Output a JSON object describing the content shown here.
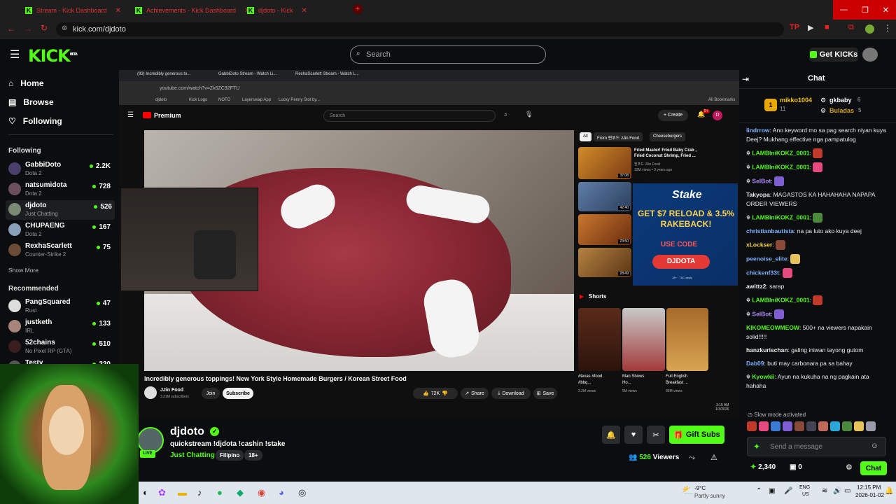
{
  "browser": {
    "tabs": [
      {
        "label": "Stream - Kick Dashboard"
      },
      {
        "label": "Achievements - Kick Dashboard"
      },
      {
        "label": "djdoto - Kick"
      }
    ],
    "url": "kick.com/djdoto"
  },
  "kick": {
    "logo": "KICK",
    "logo_sup": "BETA",
    "search_placeholder": "Search",
    "get_kicks": "Get KICKs"
  },
  "sidebar": {
    "nav": [
      {
        "label": "Home",
        "icon": "home-icon"
      },
      {
        "label": "Browse",
        "icon": "browse-icon"
      },
      {
        "label": "Following",
        "icon": "heart-icon"
      }
    ],
    "following_title": "Following",
    "following": [
      {
        "name": "GabbiDoto",
        "category": "Dota 2",
        "viewers": "2.2K"
      },
      {
        "name": "natsumidota",
        "category": "Dota 2",
        "viewers": "728"
      },
      {
        "name": "djdoto",
        "category": "Just Chatting",
        "viewers": "526"
      },
      {
        "name": "CHUPAENG",
        "category": "Dota 2",
        "viewers": "167"
      },
      {
        "name": "RexhaScarlett",
        "category": "Counter-Strike 2",
        "viewers": "75"
      }
    ],
    "show_more": "Show More",
    "recommended_title": "Recommended",
    "recommended": [
      {
        "name": "PangSquared",
        "category": "Rust",
        "viewers": "47"
      },
      {
        "name": "justketh",
        "category": "IRL",
        "viewers": "133"
      },
      {
        "name": "52chains",
        "category": "No Pixel RP (GTA)",
        "viewers": "510"
      },
      {
        "name": "Testy",
        "category": "",
        "viewers": "220"
      }
    ]
  },
  "inner": {
    "tabs": [
      "(93) Incredibly generous to...",
      "GabbiDoto Stream - Watch Li...",
      "RexhaScarlett Stream - Watch L..."
    ],
    "url": "youtube.com/watch?v=Zk6ZC92FTU",
    "bookmarks": [
      "djdoto",
      "Kick Logo",
      "NOTO",
      "Layerswap App",
      "Lucky Penny Slot by..."
    ],
    "all_bookmarks": "All Bookmarks",
    "yt_logo": "Premium",
    "yt_search": "Search",
    "create": "Create",
    "notif_count": "9+",
    "chips": [
      "All",
      "From 찐푸드 JJin Food",
      "Cheeseburgers"
    ],
    "video_title": "Incredibly generous toppings! New York Style Homemade Burgers / Korean Street Food",
    "channel": "JJin Food",
    "subs": "3.21M subscribers",
    "join": "Join",
    "subscribe": "Subscribe",
    "likes": "72K",
    "share": "Share",
    "download": "Download",
    "save": "Save",
    "side_video_title": "Fried Master! Fried Baby Crab , Fried Coconut Shrimp, Fried ...",
    "side_video_channel": "찐푸드 JJin Food",
    "side_video_meta": "12M views • 3 years ago",
    "durations": [
      "37:08",
      "42:40",
      "23:50",
      "28:49"
    ],
    "shorts_title": "Shorts",
    "shorts": [
      {
        "title": "#texas #food #bbq...",
        "views": "2.2M views"
      },
      {
        "title": "Man Shows Ho...",
        "views": "5M views"
      },
      {
        "title": "Full English Breakfast ...",
        "views": "89M views"
      }
    ],
    "clock_time": "3:15 AM",
    "clock_date": "1/3/2026",
    "stake": {
      "logo": "Stake",
      "headline": "GET $7 RELOAD & 3.5% RAKEBACK!",
      "use_code": "USE CODE",
      "code": "DJDOTA",
      "fine": "18+ · T&C apply"
    }
  },
  "stream": {
    "live_badge": "LIVE",
    "streamer": "djdoto",
    "title": "quickstream !djdota !cashin !stake",
    "category": "Just Chatting",
    "tags": [
      "Filipino",
      "18+"
    ],
    "gift_subs": "Gift Subs",
    "viewers_count": "526",
    "viewers_label": "Viewers"
  },
  "chat": {
    "title": "Chat",
    "leaderboard": [
      {
        "name": "mikko1004",
        "count": "11"
      },
      {
        "name": "gkbaby",
        "count": "6"
      },
      {
        "name": "Buladas",
        "count": "5"
      }
    ],
    "messages": [
      {
        "user": "lindrrow",
        "color": "#7fb3ff",
        "text": "Ano keyword mo sa pag search niyan kuya Deej? Mukhang effective nga pampatulog"
      },
      {
        "user": "LAMBIniKOKZ_0001",
        "color": "#53fc18",
        "text": ""
      },
      {
        "user": "LAMBIniKOKZ_0001",
        "color": "#53fc18",
        "text": ""
      },
      {
        "user": "SelBot",
        "color": "#b18cff",
        "text": ""
      },
      {
        "user": "Takyopa",
        "color": "#ffffff",
        "text": "MAGASTOS KA HAHAHAHA NAPAPA ORDER VIEWERS"
      },
      {
        "user": "LAMBIniKOKZ_0001",
        "color": "#53fc18",
        "text": ""
      },
      {
        "user": "christianbautista",
        "color": "#7fb3ff",
        "text": "na pa luto ako kuya deej"
      },
      {
        "user": "xLockser",
        "color": "#ffd84d",
        "text": ""
      },
      {
        "user": "peenoise_elite",
        "color": "#7fb3ff",
        "text": ""
      },
      {
        "user": "chickenf33t",
        "color": "#7fb3ff",
        "text": ""
      },
      {
        "user": "awittz2",
        "color": "#ffffff",
        "text": "sarap"
      },
      {
        "user": "LAMBIniKOKZ_0001",
        "color": "#53fc18",
        "text": ""
      },
      {
        "user": "SelBot",
        "color": "#b18cff",
        "text": ""
      },
      {
        "user": "KIKOMEOWMEOW",
        "color": "#53fc18",
        "text": "500+ na viewers napakain solid!!!!!"
      },
      {
        "user": "hanzkurischan",
        "color": "#ffffff",
        "text": "galing iniwan tayong gutom"
      },
      {
        "user": "Dab09",
        "color": "#7fb3ff",
        "text": "buti may carbonara pa sa bahay"
      },
      {
        "user": "Kyowkii",
        "color": "#53fc18",
        "text": "Ayun na kukuha na ng pagkain ata hahaha"
      }
    ],
    "slow_mode": "Slow mode activated",
    "send_placeholder": "Send a message",
    "points": "2,340",
    "inventory": "0",
    "chat_button": "Chat"
  },
  "taskbar": {
    "weather_temp": "-9°C",
    "weather_text": "Partly sunny",
    "lang1": "ENG",
    "lang2": "US",
    "time": "12:15 PM",
    "date": "2026-01-02"
  }
}
